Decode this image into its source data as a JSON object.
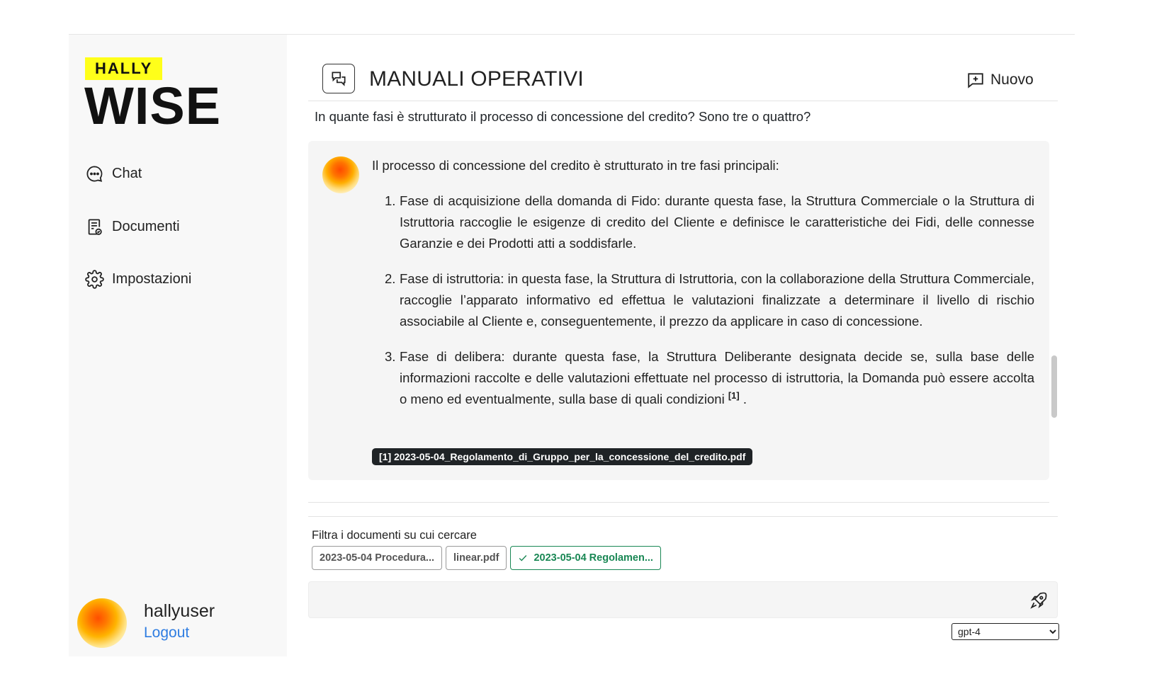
{
  "brand": {
    "tag": "HALLY",
    "name": "WISE"
  },
  "sidebar": {
    "items": [
      {
        "label": "Chat",
        "icon": "chat-bubble-icon"
      },
      {
        "label": "Documenti",
        "icon": "document-icon"
      },
      {
        "label": "Impostazioni",
        "icon": "gear-icon"
      }
    ]
  },
  "user": {
    "name": "hallyuser",
    "logout_label": "Logout"
  },
  "header": {
    "title": "MANUALI OPERATIVI",
    "new_label": "Nuovo"
  },
  "chat": {
    "question": "In quante fasi è strutturato il processo di concessione del credito? Sono tre o quattro?",
    "answer_intro": "Il processo di concessione del credito è strutturato in tre fasi principali:",
    "answer_items": [
      {
        "num": "1.",
        "text": "Fase di acquisizione della domanda di Fido: durante questa fase, la Struttura Commerciale o la Struttura di Istruttoria raccoglie le esigenze di credito del Cliente e definisce le caratteristiche dei Fidi, delle connesse Garanzie e dei Prodotti atti a soddisfarle."
      },
      {
        "num": "2.",
        "text": "Fase di istruttoria: in questa fase, la Struttura di Istruttoria, con la collaborazione della Struttura Commerciale, raccoglie l’apparato informativo ed effettua le valutazioni finalizzate a determinare il livello di rischio associabile al Cliente e, conseguentemente, il prezzo da applicare in caso di concessione."
      },
      {
        "num": "3.",
        "text": "Fase di delibera: durante questa fase, la Struttura Deliberante designata decide se, sulla base delle informazioni raccolte e delle valutazioni effettuate nel processo di istruttoria, la Domanda può essere accolta o meno ed eventualmente, sulla base di quali condizioni ",
        "citation": "[1]",
        "tail": " ."
      }
    ],
    "source_chip": "[1] 2023-05-04_Regolamento_di_Gruppo_per_la_concessione_del_credito.pdf"
  },
  "filter": {
    "label": "Filtra i documenti su cui cercare",
    "chips": [
      {
        "label": "2023-05-04 Procedura...",
        "selected": false
      },
      {
        "label": "linear.pdf",
        "selected": false
      },
      {
        "label": "2023-05-04 Regolamen...",
        "selected": true
      }
    ]
  },
  "input": {
    "value": "",
    "placeholder": ""
  },
  "model": {
    "selected": "gpt-4",
    "options": [
      "gpt-4"
    ]
  },
  "colors": {
    "brand_yellow": "#ffff1a",
    "link_blue": "#2f7de1",
    "selected_green": "#198754",
    "chip_dark": "#1f2326",
    "sidebar_bg": "#f8f8f8",
    "card_bg": "#f5f5f5"
  }
}
